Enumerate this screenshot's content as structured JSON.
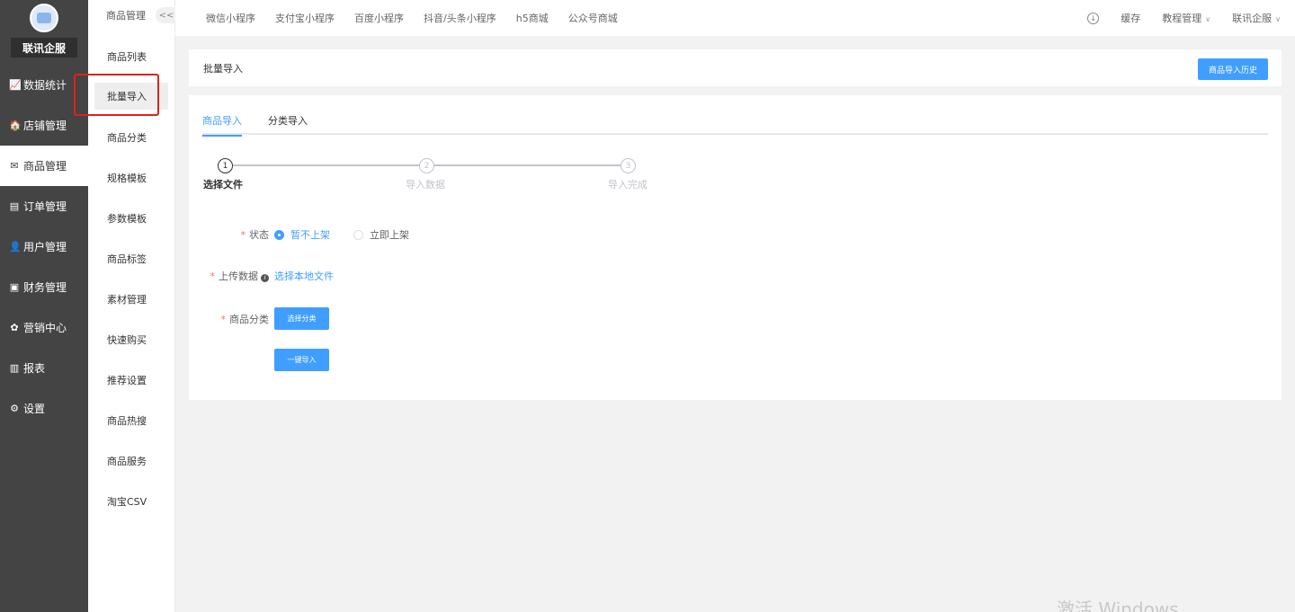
{
  "sidebar": {
    "brand": "联讯企服",
    "items": [
      {
        "label": "数据统计",
        "icon": "chart-line-icon",
        "glyph": "📈"
      },
      {
        "label": "店铺管理",
        "icon": "store-icon",
        "glyph": "🏠"
      },
      {
        "label": "商品管理",
        "icon": "product-icon",
        "glyph": "✉",
        "active": true
      },
      {
        "label": "订单管理",
        "icon": "order-icon",
        "glyph": "▤"
      },
      {
        "label": "用户管理",
        "icon": "user-icon",
        "glyph": "👤"
      },
      {
        "label": "财务管理",
        "icon": "finance-icon",
        "glyph": "▣"
      },
      {
        "label": "营销中心",
        "icon": "marketing-icon",
        "glyph": "✿"
      },
      {
        "label": "报表",
        "icon": "report-icon",
        "glyph": "▥"
      },
      {
        "label": "设置",
        "icon": "gear-icon",
        "glyph": "⚙"
      }
    ]
  },
  "subbar": {
    "title": "商品管理",
    "collapse": "<<",
    "items": [
      "商品列表",
      "批量导入",
      "商品分类",
      "规格模板",
      "参数模板",
      "商品标签",
      "素材管理",
      "快速购买",
      "推荐设置",
      "商品热搜",
      "商品服务",
      "淘宝CSV"
    ],
    "active_index": 1
  },
  "topbar": {
    "tabs": [
      "微信小程序",
      "支付宝小程序",
      "百度小程序",
      "抖音/头条小程序",
      "h5商城",
      "公众号商城"
    ],
    "cache": "缓存",
    "tutorial": "教程管理",
    "account": "联讯企服"
  },
  "header": {
    "title": "批量导入",
    "history_button": "商品导入历史"
  },
  "tabs": [
    "商品导入",
    "分类导入"
  ],
  "steps": [
    {
      "num": "1",
      "label": "选择文件"
    },
    {
      "num": "2",
      "label": "导入数据"
    },
    {
      "num": "3",
      "label": "导入完成"
    }
  ],
  "form": {
    "status_label": "状态",
    "status_options": [
      "暂不上架",
      "立即上架"
    ],
    "upload_label": "上传数据",
    "upload_link": "选择本地文件",
    "category_label": "商品分类",
    "category_button": "选择分类",
    "import_button": "一键导入"
  },
  "watermark": "激活 Windows"
}
